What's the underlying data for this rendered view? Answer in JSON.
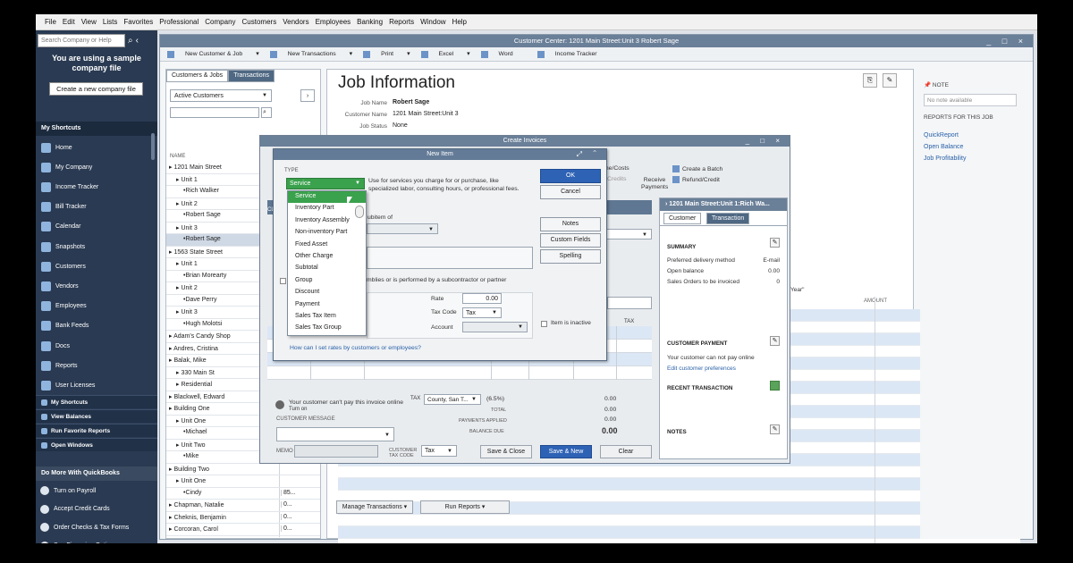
{
  "menu": [
    "File",
    "Edit",
    "View",
    "Lists",
    "Favorites",
    "Professional",
    "Company",
    "Customers",
    "Vendors",
    "Employees",
    "Banking",
    "Reports",
    "Window",
    "Help"
  ],
  "sidebar": {
    "search_placeholder": "Search Company or Help",
    "sample_msg": "You are using a sample company file",
    "create_btn": "Create a new company file",
    "shortcuts_header": "My Shortcuts",
    "items": [
      "Home",
      "My Company",
      "Income Tracker",
      "Bill Tracker",
      "Calendar",
      "Snapshots",
      "Customers",
      "Vendors",
      "Employees",
      "Bank Feeds",
      "Docs",
      "Reports",
      "User Licenses"
    ],
    "bottom_buttons": [
      "My Shortcuts",
      "View Balances",
      "Run Favorite Reports",
      "Open Windows"
    ],
    "more_header": "Do More With QuickBooks",
    "more_items": [
      "Turn on Payroll",
      "Accept Credit Cards",
      "Order Checks & Tax Forms",
      "See Financing Options"
    ]
  },
  "customer_center": {
    "title": "Customer Center: 1201 Main Street:Unit 3 Robert Sage",
    "toolbar": [
      "New Customer & Job",
      "New Transactions",
      "Print",
      "Excel",
      "Word",
      "Income Tracker"
    ],
    "tabs": [
      "Customers & Jobs",
      "Transactions"
    ],
    "filter": "Active Customers",
    "col_name": "NAME",
    "customers": [
      {
        "name": "1201 Main Street",
        "bal": ""
      },
      {
        "name": "Unit 1",
        "bal": ""
      },
      {
        "name": "Rich Walker",
        "bal": ""
      },
      {
        "name": "Unit 2",
        "bal": ""
      },
      {
        "name": "Robert Sage",
        "bal": ""
      },
      {
        "name": "Unit 3",
        "bal": ""
      },
      {
        "name": "Robert Sage",
        "bal": ""
      },
      {
        "name": "1563 State Street",
        "bal": ""
      },
      {
        "name": "Unit 1",
        "bal": ""
      },
      {
        "name": "Brian Morearty",
        "bal": ""
      },
      {
        "name": "Unit 2",
        "bal": ""
      },
      {
        "name": "Dave Perry",
        "bal": ""
      },
      {
        "name": "Unit 3",
        "bal": ""
      },
      {
        "name": "Hugh Molotsi",
        "bal": ""
      },
      {
        "name": "Adam's Candy Shop",
        "bal": ""
      },
      {
        "name": "Andres, Cristina",
        "bal": ""
      },
      {
        "name": "Balak, Mike",
        "bal": ""
      },
      {
        "name": "330 Main St",
        "bal": ""
      },
      {
        "name": "Residential",
        "bal": ""
      },
      {
        "name": "Blackwell, Edward",
        "bal": ""
      },
      {
        "name": "Building One",
        "bal": ""
      },
      {
        "name": "Unit One",
        "bal": ""
      },
      {
        "name": "Michael",
        "bal": ""
      },
      {
        "name": "Unit Two",
        "bal": ""
      },
      {
        "name": "Mike",
        "bal": ""
      },
      {
        "name": "Building Two",
        "bal": ""
      },
      {
        "name": "Unit One",
        "bal": ""
      },
      {
        "name": "Cindy",
        "bal": "85..."
      },
      {
        "name": "Chapman, Natalie",
        "bal": "0..."
      },
      {
        "name": "Cheknis, Benjamin",
        "bal": "0..."
      },
      {
        "name": "Corcoran, Carol",
        "bal": "0..."
      }
    ],
    "job_title": "Job Information",
    "job_name_label": "Job Name",
    "job_name": "Robert Sage",
    "cust_name_label": "Customer Name",
    "cust_name": "1201 Main Street:Unit 3",
    "job_status_label": "Job Status",
    "job_status": "None",
    "amount_hdr": "AMOUNT",
    "fiscal_text": "cal Year\"",
    "btn_manage": "Manage Transactions",
    "btn_reports": "Run Reports",
    "note_hdr": "NOTE",
    "note_placeholder": "No note available",
    "reports_hdr": "REPORTS FOR THIS JOB",
    "report_links": [
      "QuickReport",
      "Open Balance",
      "Job Profitability"
    ]
  },
  "create_invoices": {
    "title": "Create Invoices",
    "tool_items": [
      "me/Costs",
      "Credits",
      "Receive Payments",
      "Create a Batch",
      "Refund/Credit"
    ],
    "cust_msg_label": "CUSTOMER MESSAGE",
    "pay_online": "Your customer can't pay this invoice online",
    "turn_on": "Turn on",
    "tax_label": "TAX",
    "tax_value": "County, San T...",
    "tax_pct": "(6.5%)",
    "tax_amt": "0.00",
    "total_label": "TOTAL",
    "total": "0.00",
    "payments_label": "PAYMENTS APPLIED",
    "payments": "0.00",
    "balance_label": "BALANCE DUE",
    "balance": "0.00",
    "memo_label": "MEMO",
    "cust_tax_label": "CUSTOMER TAX CODE",
    "cust_tax_value": "Tax",
    "btn_save_close": "Save & Close",
    "btn_save_new": "Save & New",
    "btn_clear": "Clear",
    "col_tax": "TAX"
  },
  "right_panel": {
    "header": "1201 Main Street:Unit 1:Rich Wa...",
    "tabs": [
      "Customer",
      "Transaction"
    ],
    "summary_hdr": "SUMMARY",
    "rows": [
      {
        "label": "Preferred delivery method",
        "value": "E-mail"
      },
      {
        "label": "Open balance",
        "value": "0.00"
      },
      {
        "label": "Sales Orders to be invoiced",
        "value": "0"
      }
    ],
    "payment_hdr": "CUSTOMER PAYMENT",
    "payment_text": "Your customer can not pay online",
    "payment_link": "Edit customer preferences",
    "recent_hdr": "RECENT TRANSACTION",
    "notes_hdr": "NOTES"
  },
  "new_item": {
    "title": "New Item",
    "type_label": "TYPE",
    "type_value": "Service",
    "description": "Use for services you charge for or purchase, like specialized labor, consulting hours, or professional fees.",
    "types": [
      "Service",
      "Inventory Part",
      "Inventory Assembly",
      "Non-inventory Part",
      "Fixed Asset",
      "Other Charge",
      "Subtotal",
      "Group",
      "Discount",
      "Payment",
      "Sales Tax Item",
      "Sales Tax Group"
    ],
    "btn_ok": "OK",
    "btn_cancel": "Cancel",
    "btn_notes": "Notes",
    "btn_custom": "Custom Fields",
    "btn_spelling": "Spelling",
    "subitem_text": "ubitem of",
    "assemblies_text": "mblies or is performed by a subcontractor or partner",
    "rate_label": "Rate",
    "rate_value": "0.00",
    "taxcode_label": "Tax Code",
    "taxcode_value": "Tax",
    "account_label": "Account",
    "inactive_label": "Item is inactive",
    "help_link": "How can I set rates by customers or employees?"
  }
}
